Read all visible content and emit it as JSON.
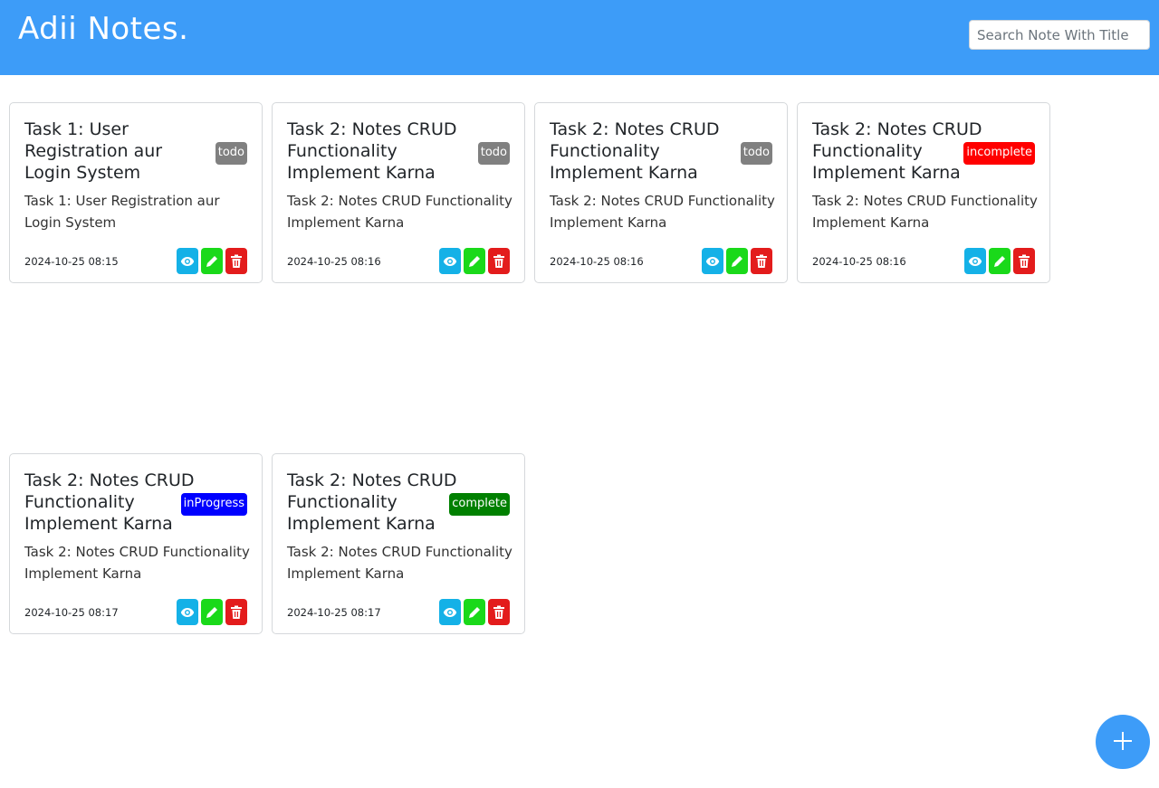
{
  "header": {
    "brand": "Adii Notes.",
    "search_placeholder": "Search Note With Title"
  },
  "colors": {
    "header_bg": "#3d9cf8",
    "view_button": "#14b1e7",
    "edit_button": "#1ad91a",
    "delete_button": "#e31c1c",
    "status_todo": "#808080",
    "status_incomplete": "#ff0000",
    "status_inProgress": "#0000ff",
    "status_complete": "#008000"
  },
  "notes": [
    {
      "title": "Task 1: User Registration aur Login System",
      "status": "todo",
      "description": "Task 1: User Registration aur Login System",
      "date": "2024-10-25 08:15"
    },
    {
      "title": "Task 2: Notes CRUD Functionality Implement Karna",
      "status": "todo",
      "description": "Task 2: Notes CRUD Functionality Implement Karna",
      "date": "2024-10-25 08:16"
    },
    {
      "title": "Task 2: Notes CRUD Functionality Implement Karna",
      "status": "todo",
      "description": "Task 2: Notes CRUD Functionality Implement Karna",
      "date": "2024-10-25 08:16"
    },
    {
      "title": "Task 2: Notes CRUD Functionality Implement Karna",
      "status": "incomplete",
      "description": "Task 2: Notes CRUD Functionality Implement Karna",
      "date": "2024-10-25 08:16"
    },
    {
      "title": "Task 2: Notes CRUD Functionality Implement Karna",
      "status": "inProgress",
      "description": "Task 2: Notes CRUD Functionality Implement Karna",
      "date": "2024-10-25 08:17"
    },
    {
      "title": "Task 2: Notes CRUD Functionality Implement Karna",
      "status": "complete",
      "description": "Task 2: Notes CRUD Functionality Implement Karna",
      "date": "2024-10-25 08:17"
    }
  ],
  "icons": {
    "view": "eye-icon",
    "edit": "pencil-icon",
    "delete": "trash-icon",
    "add": "plus-icon"
  }
}
